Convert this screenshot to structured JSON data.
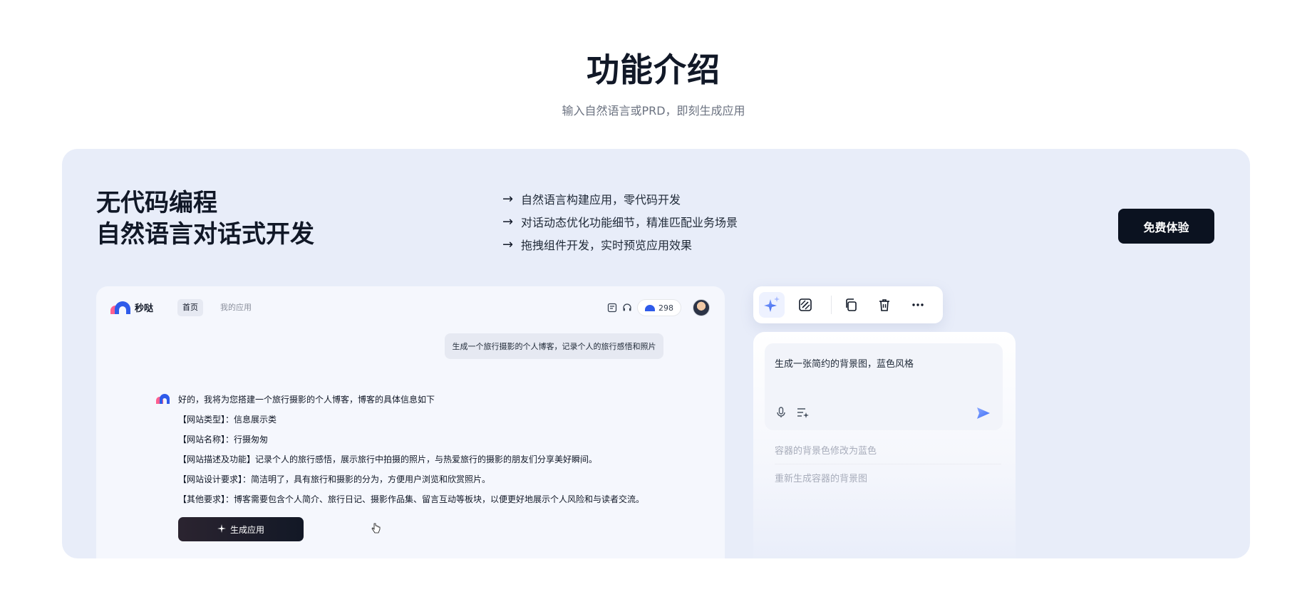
{
  "section": {
    "title": "功能介绍",
    "subtitle": "输入自然语言或PRD，即刻生成应用"
  },
  "panel": {
    "headline_line1": "无代码编程",
    "headline_line2": "自然语言对话式开发",
    "features": [
      "自然语言构建应用，零代码开发",
      "对话动态优化功能细节，精准匹配业务场景",
      "拖拽组件开发，实时预览应用效果"
    ],
    "arrow": "→",
    "cta_label": "免费体验"
  },
  "app": {
    "logo_text": "秒哒",
    "nav_home": "首页",
    "nav_apps": "我的应用",
    "credits": "298",
    "user_message": "生成一个旅行摄影的个人博客，记录个人的旅行感悟和照片",
    "bot_lines": [
      "好的，我将为您搭建一个旅行摄影的个人博客，博客的具体信息如下",
      "【网站类型】：信息展示类",
      "【网站名称】：行摄匆匆",
      "【网站描述及功能】记录个人的旅行感悟，展示旅行中拍摄的照片，与热爱旅行的摄影的朋友们分享美好瞬间。",
      "【网站设计要求】：简洁明了，具有旅行和摄影的分为，方便用户浏览和欣赏照片。",
      "【其他要求】：博客需要包含个人简介、旅行日记、摄影作品集、留言互动等板块，以便更好地展示个人风险和与读者交流。"
    ],
    "generate_label": "生成应用"
  },
  "editor": {
    "input_text": "生成一张简约的背景图，蓝色风格",
    "suggestions": [
      "容器的背景色修改为蓝色",
      "重新生成容器的背景图"
    ]
  },
  "colors": {
    "panel_bg": "#e8edf9",
    "cta_bg": "#0b1220",
    "accent_blue": "#3b6cf6",
    "logo_pink": "#ff5f8f"
  },
  "icons": [
    "arrow-right-icon",
    "notes-icon",
    "headset-icon",
    "sparkle-icon",
    "edit-icon",
    "copy-icon",
    "trash-icon",
    "more-icon",
    "mic-icon",
    "list-icon",
    "send-icon",
    "cursor-hand-icon"
  ]
}
